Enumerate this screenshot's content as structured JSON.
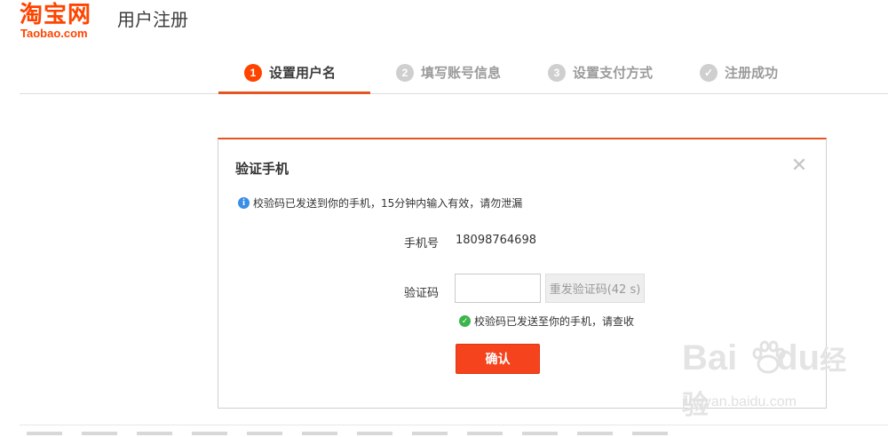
{
  "header": {
    "logo_cn": "淘宝网",
    "logo_en": "Taobao.com",
    "title": "用户注册"
  },
  "steps": [
    {
      "num": "1",
      "label": "设置用户名",
      "state": "active"
    },
    {
      "num": "2",
      "label": "填写账号信息",
      "state": "inactive"
    },
    {
      "num": "3",
      "label": "设置支付方式",
      "state": "inactive"
    },
    {
      "num": "✓",
      "label": "注册成功",
      "state": "inactive"
    }
  ],
  "dialog": {
    "title": "验证手机",
    "close_icon": "close-icon",
    "info_text": "校验码已发送到你的手机，15分钟内输入有效，请勿泄漏",
    "phone_label": "手机号",
    "phone_value": "18098764698",
    "code_label": "验证码",
    "code_value": "",
    "resend_label": "重发验证码(42 s)",
    "sent_text": "校验码已发送至你的手机，请查收",
    "confirm_label": "确认"
  },
  "watermark": {
    "main_left": "Bai",
    "main_right": "du",
    "main_cn": "经验",
    "sub": "jingyan.baidu.com"
  },
  "colors": {
    "accent": "#ff4400",
    "button": "#f5431e",
    "info": "#3a8ee6",
    "success": "#3bb54a"
  }
}
